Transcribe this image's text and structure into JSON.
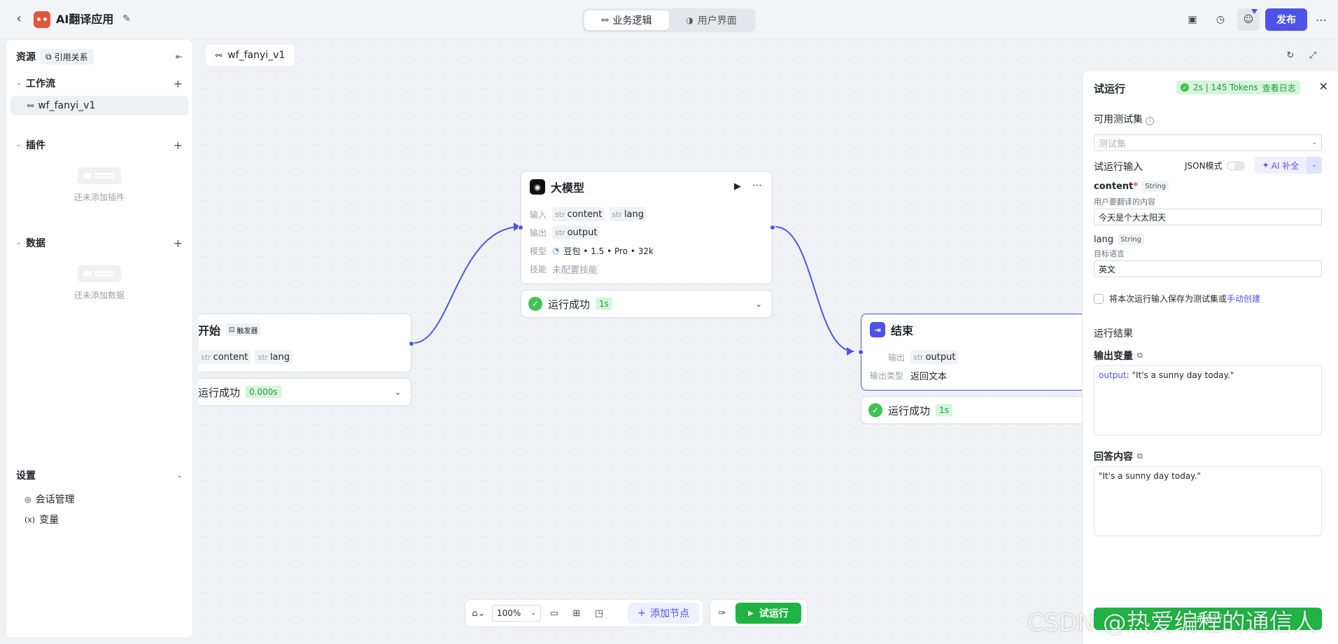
{
  "header": {
    "app_title": "AI翻译应用",
    "tabs": [
      {
        "label": "业务逻辑",
        "active": true
      },
      {
        "label": "用户界面",
        "active": false
      }
    ],
    "publish_label": "发布"
  },
  "sidebar": {
    "title": "资源",
    "ref_chip": "引用关系",
    "sections": {
      "workflow": {
        "label": "工作流",
        "items": [
          "wf_fanyi_v1"
        ]
      },
      "plugin": {
        "label": "插件",
        "empty_text": "还未添加插件"
      },
      "data": {
        "label": "数据",
        "empty_text": "还未添加数据"
      }
    },
    "settings": {
      "label": "设置",
      "items": [
        "会话管理",
        "变量"
      ]
    }
  },
  "canvas": {
    "tab_label": "wf_fanyi_v1",
    "nodes": {
      "start": {
        "title": "开始",
        "trigger_label": "触发器",
        "outputs": [
          "content",
          "lang"
        ],
        "status": "运行成功",
        "duration": "0.000s"
      },
      "llm": {
        "title": "大模型",
        "input_label": "输入",
        "inputs": [
          "content",
          "lang"
        ],
        "output_label": "输出",
        "outputs": [
          "output"
        ],
        "model_label": "模型",
        "model_value": "豆包 • 1.5 • Pro • 32k",
        "skill_label": "技能",
        "skill_value": "未配置技能",
        "status": "运行成功",
        "duration": "1s"
      },
      "end": {
        "title": "结束",
        "output_label": "输出",
        "outputs": [
          "output"
        ],
        "output_type_label": "输出类型",
        "output_type_value": "返回文本",
        "status": "运行成功",
        "duration": "1s"
      }
    },
    "type_prefix": "str",
    "toolbar": {
      "zoom": "100%",
      "add_node_label": "添加节点",
      "run_label": "试运行"
    }
  },
  "test_panel": {
    "title": "试运行",
    "meta": "2s | 145 Tokens",
    "log_link": "查看日志",
    "testset_label": "可用测试集",
    "testset_placeholder": "测试集",
    "input_label": "试运行输入",
    "json_mode_label": "JSON模式",
    "ai_fill_label": "AI 补全",
    "vars": [
      {
        "name": "content",
        "required": true,
        "type": "String",
        "desc": "用户要翻译的内容",
        "value": "今天是个大太阳天"
      },
      {
        "name": "lang",
        "required": false,
        "type": "String",
        "desc": "目标语言",
        "value": "英文"
      }
    ],
    "save_text": "将本次运行输入保存为测试集或",
    "save_link": "手动创建",
    "result_label": "运行结果",
    "output_var_label": "输出变量",
    "output_key": "output",
    "output_value": ": \"It's a sunny day today.\"",
    "answer_label": "回答内容",
    "answer_value": "\"It's a sunny day today.\"",
    "run_button": "试运行"
  },
  "watermark": "CSDN @热爱编程的通信人",
  "colors": {
    "accent": "#4d53e8",
    "success": "#1fb344",
    "edge": "#4d53e8"
  }
}
